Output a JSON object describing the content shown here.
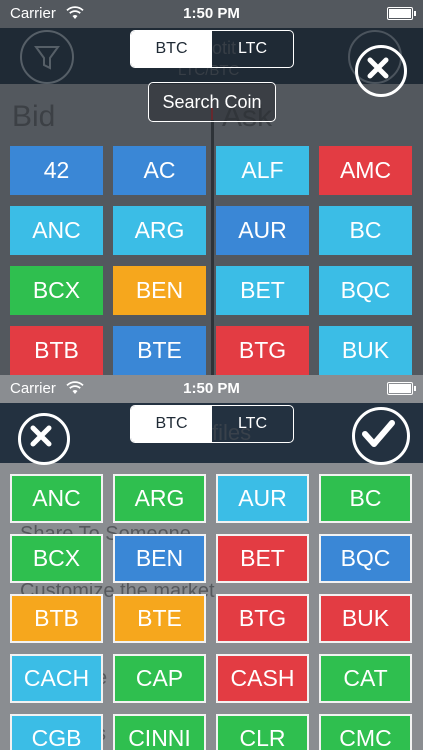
{
  "top": {
    "status": {
      "carrier": "Carrier",
      "time": "1:50 PM"
    },
    "tabs": [
      {
        "label": "BTC",
        "active": true
      },
      {
        "label": "LTC",
        "active": false
      }
    ],
    "search_label": "Search Coin",
    "bg": {
      "title_partial": "otit",
      "pair": "LTC/BTC",
      "bid": "Bid",
      "ask": "Ask"
    },
    "coins": [
      {
        "label": "42",
        "color": "#3a87d6"
      },
      {
        "label": "AC",
        "color": "#3a87d6"
      },
      {
        "label": "ALF",
        "color": "#3bbde6"
      },
      {
        "label": "AMC",
        "color": "#e33c43"
      },
      {
        "label": "ANC",
        "color": "#3bbde6"
      },
      {
        "label": "ARG",
        "color": "#3bbde6"
      },
      {
        "label": "AUR",
        "color": "#3a87d6"
      },
      {
        "label": "BC",
        "color": "#3bbde6"
      },
      {
        "label": "BCX",
        "color": "#2fbf4f"
      },
      {
        "label": "BEN",
        "color": "#f6a71d"
      },
      {
        "label": "BET",
        "color": "#3bbde6"
      },
      {
        "label": "BQC",
        "color": "#3bbde6"
      },
      {
        "label": "BTB",
        "color": "#e33c43"
      },
      {
        "label": "BTE",
        "color": "#3a87d6"
      },
      {
        "label": "BTG",
        "color": "#e33c43"
      },
      {
        "label": "BUK",
        "color": "#3bbde6"
      }
    ]
  },
  "bottom": {
    "status": {
      "carrier": "Carrier",
      "time": "1:50 PM"
    },
    "tabs": [
      {
        "label": "BTC",
        "active": true
      },
      {
        "label": "LTC",
        "active": false
      }
    ],
    "bg": {
      "title_partial": "files",
      "share": "Share To Someone",
      "customize": "Customize the market",
      "partial_e": "e",
      "partial_s": "s"
    },
    "coins": [
      {
        "label": "ANC",
        "color": "#2fbf4f"
      },
      {
        "label": "ARG",
        "color": "#2fbf4f"
      },
      {
        "label": "AUR",
        "color": "#3bbde6"
      },
      {
        "label": "BC",
        "color": "#2fbf4f"
      },
      {
        "label": "BCX",
        "color": "#2fbf4f"
      },
      {
        "label": "BEN",
        "color": "#3a87d6"
      },
      {
        "label": "BET",
        "color": "#e33c43"
      },
      {
        "label": "BQC",
        "color": "#3a87d6"
      },
      {
        "label": "BTB",
        "color": "#f6a71d"
      },
      {
        "label": "BTE",
        "color": "#f6a71d"
      },
      {
        "label": "BTG",
        "color": "#e33c43"
      },
      {
        "label": "BUK",
        "color": "#e33c43"
      },
      {
        "label": "CACH",
        "color": "#3bbde6"
      },
      {
        "label": "CAP",
        "color": "#2fbf4f"
      },
      {
        "label": "CASH",
        "color": "#e33c43"
      },
      {
        "label": "CAT",
        "color": "#2fbf4f"
      },
      {
        "label": "CGB",
        "color": "#3bbde6"
      },
      {
        "label": "CINNI",
        "color": "#2fbf4f"
      },
      {
        "label": "CLR",
        "color": "#2fbf4f"
      },
      {
        "label": "CMC",
        "color": "#2fbf4f"
      }
    ]
  }
}
